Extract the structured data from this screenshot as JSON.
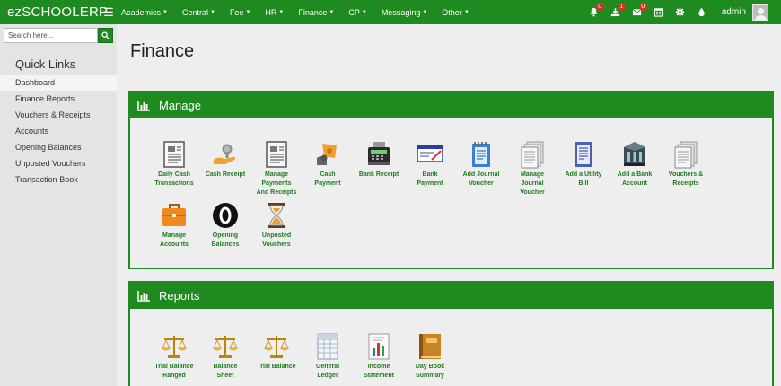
{
  "topbar": {
    "brand": "ezSCHOOLERP",
    "menu": [
      {
        "label": "Academics"
      },
      {
        "label": "Central"
      },
      {
        "label": "Fee"
      },
      {
        "label": "HR"
      },
      {
        "label": "Finance"
      },
      {
        "label": "CP"
      },
      {
        "label": "Messaging"
      },
      {
        "label": "Other"
      }
    ],
    "badges": {
      "notifications": "0",
      "downloads": "1",
      "mail": "0"
    },
    "user": "admin"
  },
  "sidebar": {
    "search_placeholder": "Search here...",
    "quick_links_title": "Quick Links",
    "items": [
      {
        "label": "Dashboard"
      },
      {
        "label": "Finance Reports"
      },
      {
        "label": "Vouchers & Receipts"
      },
      {
        "label": "Accounts"
      },
      {
        "label": "Opening Balances"
      },
      {
        "label": "Unposted Vouchers"
      },
      {
        "label": "Transaction Book"
      }
    ]
  },
  "main": {
    "title": "Finance",
    "manage": {
      "title": "Manage",
      "tiles": [
        {
          "l1": "Daily Cash",
          "l2": "Transactions",
          "l3": "",
          "icon": "document-icon"
        },
        {
          "l1": "Cash Receipt",
          "l2": "",
          "l3": "",
          "icon": "hand-coin-icon"
        },
        {
          "l1": "Manage",
          "l2": "Payments",
          "l3": "And Receipts",
          "icon": "document-icon"
        },
        {
          "l1": "Cash",
          "l2": "Payment",
          "l3": "",
          "icon": "cash-payment-icon"
        },
        {
          "l1": "Bank Receipt",
          "l2": "",
          "l3": "",
          "icon": "cash-register-icon"
        },
        {
          "l1": "Bank",
          "l2": "Payment",
          "l3": "",
          "icon": "cheque-icon"
        },
        {
          "l1": "Add Journal",
          "l2": "Voucher",
          "l3": "",
          "icon": "notepad-icon"
        },
        {
          "l1": "Manage",
          "l2": "Journal",
          "l3": "Voucher",
          "icon": "stacked-documents-icon"
        },
        {
          "l1": "Add a Utility",
          "l2": "Bill",
          "l3": "",
          "icon": "bill-icon"
        },
        {
          "l1": "Add a Bank",
          "l2": "Account",
          "l3": "",
          "icon": "bank-building-icon"
        },
        {
          "l1": "Vouchers &",
          "l2": "Receipts",
          "l3": "",
          "icon": "stacked-documents-icon"
        },
        {
          "l1": "Manage",
          "l2": "Accounts",
          "l3": "",
          "icon": "briefcase-icon"
        },
        {
          "l1": "Opening",
          "l2": "Balances",
          "l3": "",
          "icon": "zero-balance-icon"
        },
        {
          "l1": "Unposted",
          "l2": "Vouchers",
          "l3": "",
          "icon": "hourglass-icon"
        }
      ]
    },
    "reports": {
      "title": "Reports",
      "tiles": [
        {
          "l1": "Trial Balance",
          "l2": "Ranged",
          "l3": "",
          "icon": "scales-icon"
        },
        {
          "l1": "Balance",
          "l2": "Sheet",
          "l3": "",
          "icon": "scales-icon"
        },
        {
          "l1": "Trial Balance",
          "l2": "",
          "l3": "",
          "icon": "scales-icon"
        },
        {
          "l1": "General",
          "l2": "Ledger",
          "l3": "",
          "icon": "spreadsheet-icon"
        },
        {
          "l1": "Income",
          "l2": "Statement",
          "l3": "",
          "icon": "bar-report-icon"
        },
        {
          "l1": "Day Book",
          "l2": "Summary",
          "l3": "",
          "icon": "book-icon"
        }
      ]
    }
  }
}
